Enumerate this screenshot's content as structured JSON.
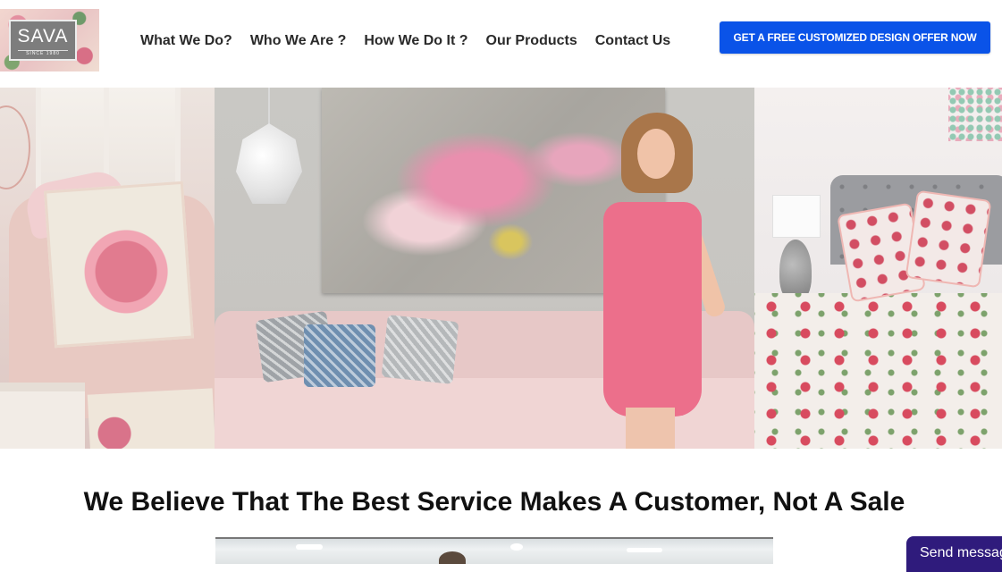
{
  "logo": {
    "text": "SAVA",
    "subtext": "SINCE 1980"
  },
  "nav": {
    "items": [
      {
        "label": "What We Do?"
      },
      {
        "label": "Who We Are ?"
      },
      {
        "label": "How We Do It ?"
      },
      {
        "label": "Our Products"
      },
      {
        "label": "Contact Us"
      }
    ]
  },
  "header": {
    "cta_label": "GET A FREE CUSTOMIZED DESIGN OFFER NOW"
  },
  "colors": {
    "accent": "#0a53e8",
    "chat": "#2f1b7c",
    "heading": "#111111"
  },
  "main": {
    "headline": "We Believe That The Best Service Makes A Customer, Not A Sale"
  },
  "chat": {
    "label": "Send message"
  }
}
